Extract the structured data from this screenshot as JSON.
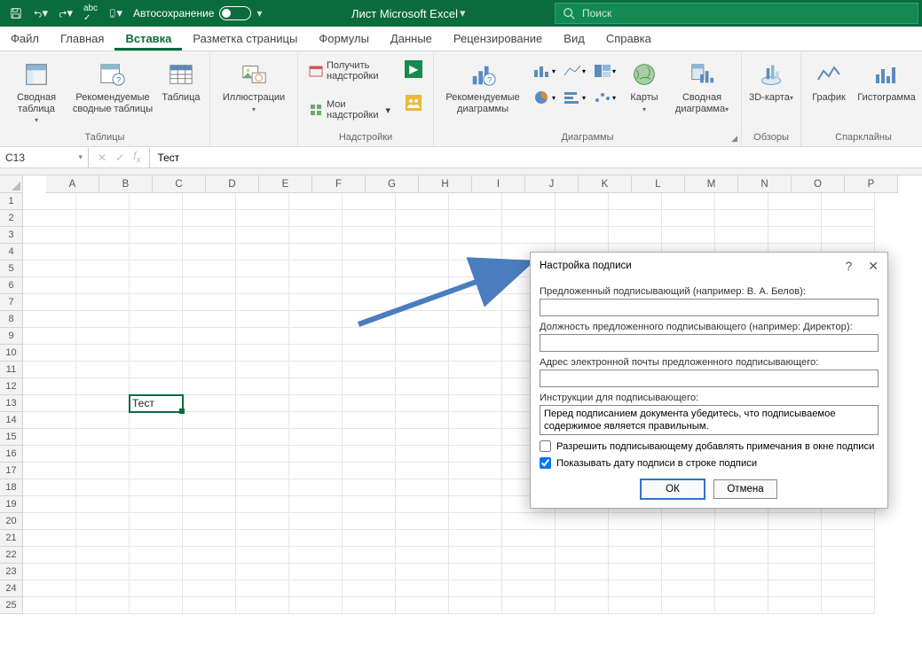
{
  "titlebar": {
    "autosave_label": "Автосохранение",
    "doc_title": "Лист Microsoft Excel",
    "search_placeholder": "Поиск"
  },
  "menu": [
    "Файл",
    "Главная",
    "Вставка",
    "Разметка страницы",
    "Формулы",
    "Данные",
    "Рецензирование",
    "Вид",
    "Справка"
  ],
  "menu_active": 2,
  "ribbon": {
    "groups": {
      "tables": {
        "label": "Таблицы",
        "pivot": "Сводная таблица",
        "rec": "Рекомендуемые сводные таблицы",
        "table": "Таблица"
      },
      "illus": {
        "label": "",
        "btn": "Иллюстрации"
      },
      "addins": {
        "label": "Надстройки",
        "get": "Получить надстройки",
        "mine": "Мои надстройки"
      },
      "charts": {
        "label": "Диаграммы",
        "rec": "Рекомендуемые диаграммы",
        "maps": "Карты",
        "pivotc": "Сводная диаграмма"
      },
      "tours": {
        "label": "Обзоры",
        "map3d": "3D-карта"
      },
      "spark": {
        "label": "Спарклайны",
        "line": "График",
        "col": "Гистограмма"
      }
    }
  },
  "namebox": "C13",
  "formula": "Тест",
  "columns": [
    "A",
    "B",
    "C",
    "D",
    "E",
    "F",
    "G",
    "H",
    "I",
    "J",
    "K",
    "L",
    "M",
    "N",
    "O",
    "P"
  ],
  "rows": 25,
  "active_cell": {
    "row": 13,
    "col": 3
  },
  "cell_value": "Тест",
  "dialog": {
    "title": "Настройка подписи",
    "lbl_signer": "Предложенный подписывающий (например: В. А. Белов):",
    "lbl_job": "Должность предложенного подписывающего (например: Директор):",
    "lbl_email": "Адрес электронной почты предложенного подписывающего:",
    "lbl_instr": "Инструкции для подписывающего:",
    "instr_val": "Перед подписанием документа убедитесь, что подписываемое содержимое является правильным.",
    "chk_comments": "Разрешить подписывающему добавлять примечания в окне подписи",
    "chk_date": "Показывать дату подписи в строке подписи",
    "ok": "ОК",
    "cancel": "Отмена"
  }
}
